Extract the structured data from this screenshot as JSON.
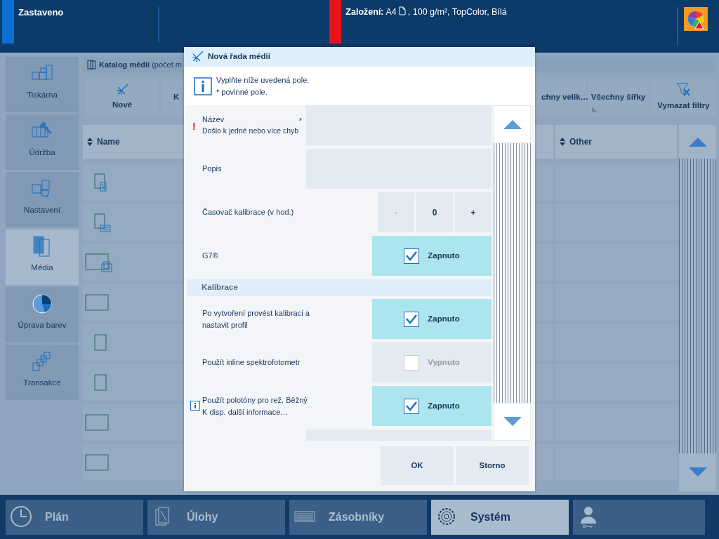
{
  "top_bar": {
    "segments": [
      {
        "kind": "status",
        "label": "Zastaveno",
        "color": "#0a6fd0"
      },
      {
        "kind": "media",
        "label": "Založení:",
        "size": "A4",
        "details": ", 100 g/m², TopColor, Bílá",
        "color": "#e8141c"
      }
    ]
  },
  "sidebar": {
    "items": [
      {
        "label": "Tiskárna",
        "selected": false
      },
      {
        "label": "Údržba",
        "selected": false
      },
      {
        "label": "Nastavení",
        "selected": false
      },
      {
        "label": "Média",
        "selected": true
      },
      {
        "label": "Úprava barev",
        "selected": false
      },
      {
        "label": "Transakce",
        "selected": false
      }
    ]
  },
  "catalog": {
    "title": "**Katalog médií** (počet m",
    "toolbar": [
      {
        "kind": "new",
        "label": "Nové"
      },
      {
        "kind": "plain",
        "label": "K"
      },
      {
        "kind": "filter",
        "label": "chny velik…"
      },
      {
        "kind": "filter",
        "label": "Všechny šířky"
      },
      {
        "kind": "clear",
        "label": "Vymazat filtry"
      }
    ],
    "columns": [
      "Name",
      "Other"
    ],
    "rows": [
      {
        "kind": "duplex"
      },
      {
        "kind": "tab"
      },
      {
        "kind": "landscape-stack"
      },
      {
        "kind": "landscape"
      },
      {
        "kind": "portrait"
      },
      {
        "kind": "portrait"
      },
      {
        "kind": "landscape"
      },
      {
        "kind": "landscape"
      }
    ]
  },
  "dialog": {
    "title": "Nová řada médií",
    "info": [
      "Vyplňte níže uvedená pole.",
      "* povinné pole."
    ],
    "rows": [
      {
        "kind": "text",
        "label": "Název",
        "error": "Došlo k jedné nebo více chyb",
        "error_mark": "!",
        "required_mark": "*"
      },
      {
        "kind": "text",
        "label": "Popis"
      },
      {
        "kind": "stepper",
        "label": "Časovač kalibrace (v hod.)",
        "minus": "-",
        "minus_disabled": true,
        "value": "0",
        "plus": "+"
      },
      {
        "kind": "toggle",
        "label": "G7®",
        "checked": true,
        "state": "Zapnuto"
      },
      {
        "kind": "section",
        "label": "Kalibrace"
      },
      {
        "kind": "toggle",
        "label": "Po vytvoření provést kalibraci a nastavit profil",
        "checked": true,
        "state": "Zapnuto"
      },
      {
        "kind": "toggle",
        "label": "Použít inline spektrofotometr",
        "checked": false,
        "state": "Vypnuto"
      },
      {
        "kind": "toggle",
        "label": "Použít polotóny pro rež. Běžný",
        "info": "K disp. další informace…",
        "checked": true,
        "state": "Zapnuto"
      },
      {
        "kind": "text"
      }
    ],
    "buttons": [
      "OK",
      "Storno"
    ]
  },
  "bottom_nav": [
    {
      "kind": "plan",
      "label": "Plán",
      "selected": false
    },
    {
      "kind": "jobs",
      "label": "Úlohy",
      "selected": false
    },
    {
      "kind": "trays",
      "label": "Zásobníky",
      "selected": false
    },
    {
      "kind": "system",
      "label": "Systém",
      "selected": true
    },
    {
      "kind": "user",
      "selected": false
    }
  ]
}
